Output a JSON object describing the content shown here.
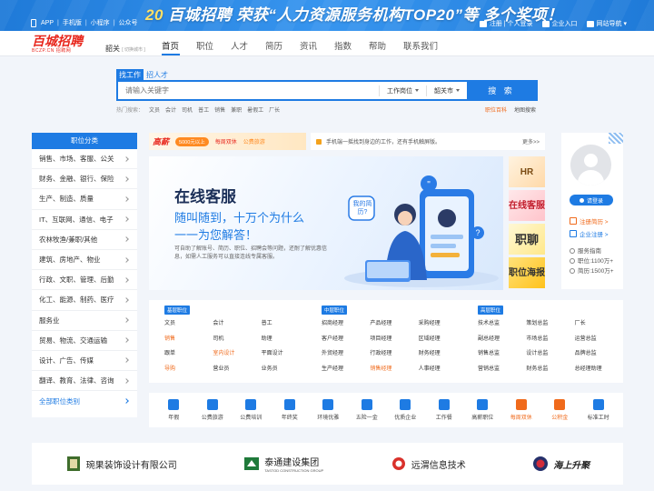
{
  "topbar": {
    "app": "APP",
    "mobile": "手机版",
    "mini": "小程序",
    "official": "公众号",
    "banner_brand": "百城招聘",
    "banner_text": "荣获“人力资源服务机构TOP20”等 多个奖项！",
    "register_login": "注册 | 个人登录",
    "enterprise": "企业入口",
    "sitemap": "网站导航"
  },
  "header": {
    "logo_main": "百城招聘",
    "logo_sub": "BCZP.CN 招聘网",
    "city": "韶关",
    "city_switch": "[ 切换城市 ]",
    "nav": [
      "首页",
      "职位",
      "人才",
      "简历",
      "资讯",
      "指数",
      "帮助",
      "联系我们"
    ]
  },
  "search": {
    "tab_job": "找工作",
    "tab_talent": "招人才",
    "placeholder": "请输入关键字",
    "type_select": "工作岗位",
    "city_select": "韶关市",
    "button": "搜 索",
    "hot_label": "热门搜索：",
    "hot_keywords": [
      "文员",
      "会计",
      "司机",
      "普工",
      "销售",
      "兼职",
      "暑假工",
      "厂长"
    ],
    "link_complete": "职位百科",
    "link_map": "地图搜索"
  },
  "categories": {
    "title": "职位分类",
    "items": [
      "销售、市场、客服、公关",
      "财务、金融、银行、保险",
      "生产、制造、质量",
      "IT、互联网、通信、电子",
      "农林牧渔/兼职/其他",
      "建筑、房地产、物业",
      "行政、文职、管理、后勤",
      "化工、能源、制药、医疗",
      "服务业",
      "贸易、物流、交通运输",
      "设计、广告、传媒",
      "翻译、教育、法律、咨询"
    ],
    "all": "全部职位类别"
  },
  "ad_strip": {
    "brand": "高薪",
    "badge": "5000元以上",
    "r1": "每周双休",
    "r2": "公费旅游"
  },
  "notice": {
    "text": "手机端一摇找到身边的工作，还有手机触屏版。",
    "more": "更多>>"
  },
  "hero": {
    "title": "在线客服",
    "line1": "随叫随到，十万个为什么",
    "line2": "一一为您解答！",
    "desc": "可自助了解账号、简历、职位、招聘会等问题，还耐了解优惠信息，如需人工服务可以直接连线专属客服。",
    "bubble": "我的简历?"
  },
  "side_ads": [
    "HR",
    "在线客服",
    "职聊",
    "职位海报"
  ],
  "user_panel": {
    "login": "请登录",
    "register_resume": "注册简历 >",
    "register_company": "企业注册 >",
    "service": "服务指南",
    "jobs_count": "职位:1100万+",
    "resume_count": "简历:1500万+"
  },
  "jobs": {
    "basic": {
      "title": "基层职位",
      "items": [
        "文员",
        "会计",
        "普工",
        "销售",
        "司机",
        "助理",
        "跟单",
        "室内设计",
        "平面设计",
        "导购",
        "营业员",
        "业务员"
      ]
    },
    "middle": {
      "title": "中层职位",
      "items": [
        "招商经理",
        "产品经理",
        "采购经理",
        "客户经理",
        "项目经理",
        "区域经理",
        "外贸经理",
        "行政经理",
        "财务经理",
        "生产经理",
        "销售经理",
        "人事经理"
      ]
    },
    "senior": {
      "title": "高层职位",
      "items": [
        "技术总监",
        "策划总监",
        "厂长",
        "副总经理",
        "市场总监",
        "运营总监",
        "销售总监",
        "设计总监",
        "品牌总监",
        "营销总监",
        "财务总监",
        "总经理助理"
      ]
    },
    "highlight": [
      "销售",
      "室内设计",
      "导购",
      "销售经理"
    ]
  },
  "quick_links": [
    "年假",
    "公费旅游",
    "公费培训",
    "年终奖",
    "环境优雅",
    "五险一金",
    "优质企业",
    "工作餐",
    "高薪职位",
    "每周双休",
    "公积金",
    "标准工时"
  ],
  "quick_highlight": [
    "每周双休",
    "公积金"
  ],
  "partners": [
    {
      "name": "琬果装饰设计有限公司",
      "sub": ""
    },
    {
      "name": "泰通建设集团",
      "sub": "TASTOD CONSTRUCTION GROUP"
    },
    {
      "name": "远渭信息技术",
      "sub": ""
    },
    {
      "name": "海上升聚",
      "sub": ""
    }
  ],
  "colors": {
    "primary": "#1e7be3",
    "accent": "#f06a1b",
    "brand_red": "#e8261c"
  }
}
